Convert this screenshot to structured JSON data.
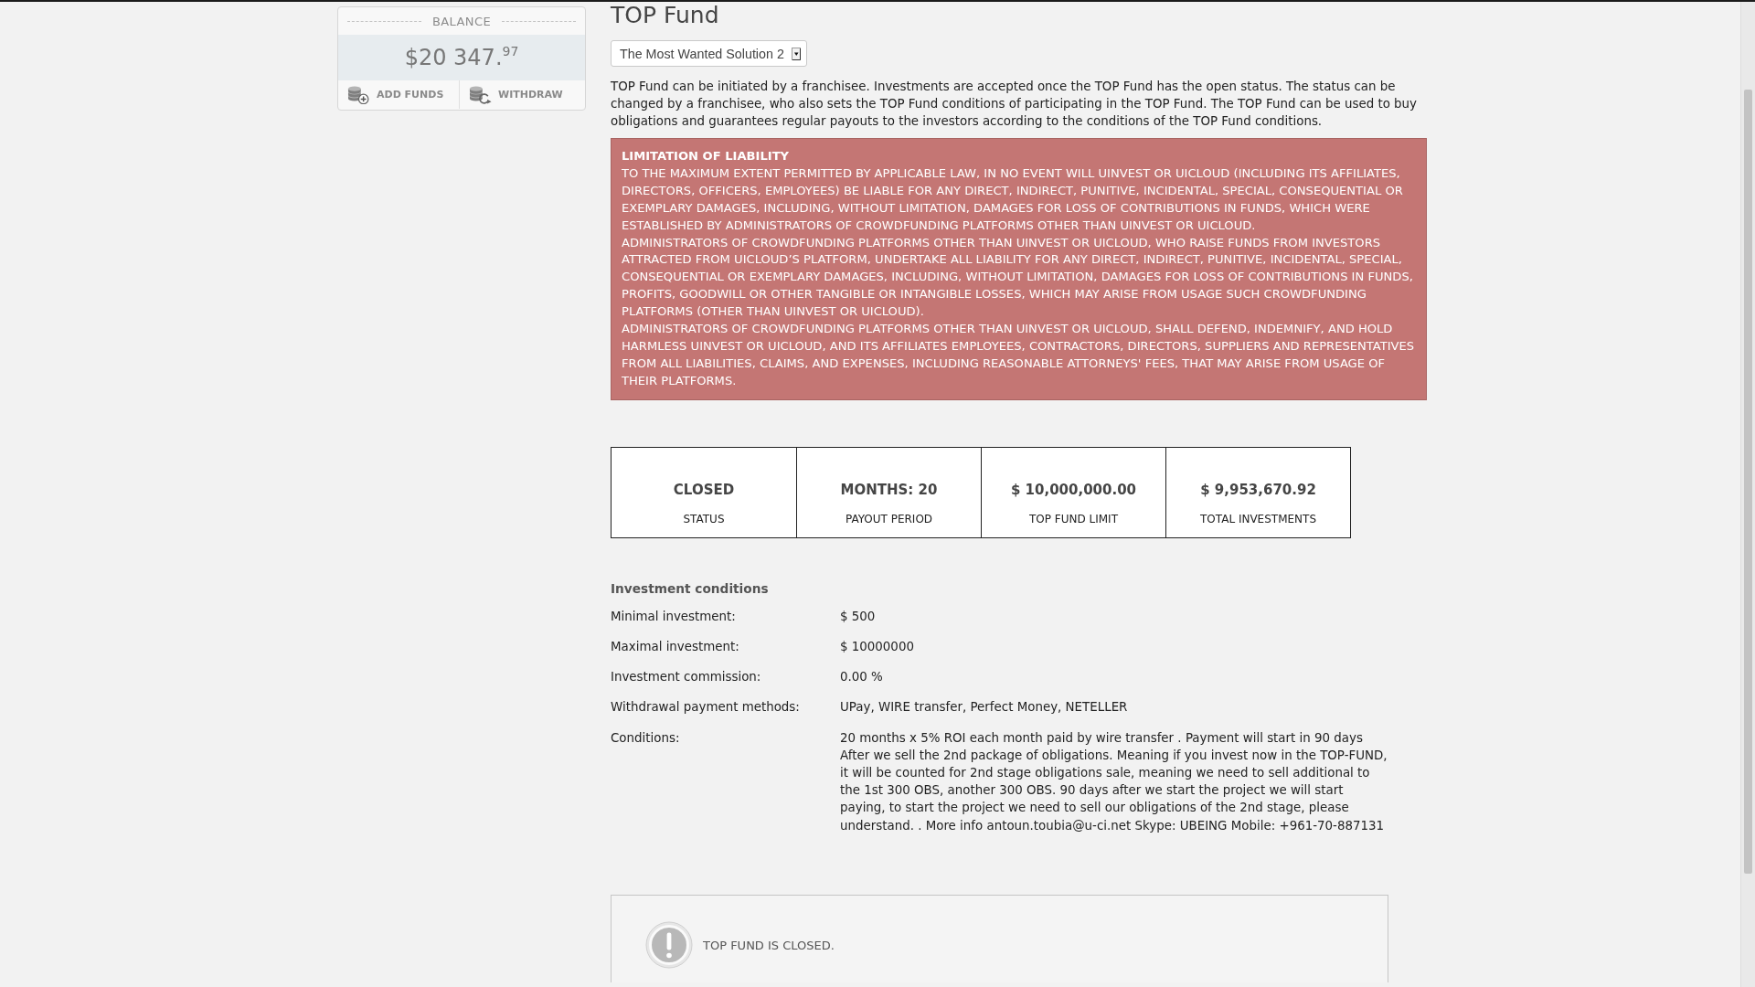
{
  "balance": {
    "heading": "BALANCE",
    "amount": "$20 347.$^{97}$",
    "actions": [
      {
        "label": "ADD FUNDS",
        "kind": "add"
      },
      {
        "label": "WITHDRAW",
        "kind": "withdraw"
      }
    ]
  },
  "title": "TOP Fund",
  "fund_select": {
    "value": "The Most Wanted Solution 2"
  },
  "intro": "TOP Fund can be initiated by a franchisee. Investments are accepted once the TOP Fund has the open status. The status can be changed by a franchisee, who also sets the TOP Fund conditions of participating in the TOP Fund. The TOP Fund can be used to buy obligations and guarantees regular payouts to the investors according to the conditions of the TOP Fund conditions.",
  "liability": {
    "title": "LIMITATION OF LIABILITY",
    "paragraphs": [
      "TO THE MAXIMUM EXTENT PERMITTED BY APPLICABLE LAW, IN NO EVENT WILL UINVEST OR UICLOUD (INCLUDING ITS AFFILIATES, DIRECTORS, OFFICERS, EMPLOYEES) BE LIABLE FOR ANY DIRECT, INDIRECT, PUNITIVE, INCIDENTAL, SPECIAL, CONSEQUENTIAL OR EXEMPLARY DAMAGES, INCLUDING, WITHOUT LIMITATION, DAMAGES FOR LOSS OF CONTRIBUTIONS IN FUNDS, WHICH WERE ESTABLISHED BY ADMINISTRATORS OF CROWDFUNDING PLATFORMS OTHER THAN UINVEST OR UICLOUD.",
      "ADMINISTRATORS OF CROWDFUNDING PLATFORMS OTHER THAN UINVEST OR UICLOUD, WHO RAISE FUNDS FROM INVESTORS ATTRACTED FROM UICLOUD’S PLATFORM, UNDERTAKE ALL LIABILITY FOR ANY DIRECT, INDIRECT, PUNITIVE, INCIDENTAL, SPECIAL, CONSEQUENTIAL OR EXEMPLARY DAMAGES, INCLUDING, WITHOUT LIMITATION, DAMAGES FOR LOSS OF CONTRIBUTIONS IN FUNDS, PROFITS, GOODWILL OR OTHER TANGIBLE OR INTANGIBLE LOSSES, WHICH MAY ARISE FROM USAGE SUCH CROWDFUNDING PLATFORMS (OTHER THAN UINVEST OR UICLOUD).",
      "ADMINISTRATORS OF CROWDFUNDING PLATFORMS OTHER THAN UINVEST OR UICLOUD, SHALL DEFEND, INDEMNIFY, AND HOLD HARMLESS UINVEST OR UICLOUD, AND ITS AFFILIATES EMPLOYEES, CONTRACTORS, DIRECTORS, SUPPLIERS AND REPRESENTATIVES FROM ALL LIABILITIES, CLAIMS, AND EXPENSES, INCLUDING REASONABLE ATTORNEYS' FEES, THAT MAY ARISE FROM USAGE OF THEIR PLATFORMS."
    ]
  },
  "stats": [
    {
      "value": "CLOSED",
      "label": "STATUS"
    },
    {
      "value": "MONTHS: 20",
      "label": "PAYOUT PERIOD"
    },
    {
      "value": "$ 10,000,000.00",
      "label": "TOP FUND LIMIT"
    },
    {
      "value": "$ 9,953,670.92",
      "label": "TOTAL INVESTMENTS"
    }
  ],
  "conditions": {
    "title": "Investment conditions",
    "rows": [
      {
        "label": "Minimal investment:",
        "value": "$ 500"
      },
      {
        "label": "Maximal investment:",
        "value": "$ 10000000"
      },
      {
        "label": "Investment commission:",
        "value": "0.00 %"
      },
      {
        "label": "Withdrawal payment methods:",
        "value": "UPay, WIRE transfer, Perfect Money, NETELLER"
      },
      {
        "label": "Conditions:",
        "value": "20 months x 5% ROI each month paid by wire transfer . Payment will start in 90 days\nAfter we sell the 2nd package of obligations. Meaning if you invest now in the TOP-FUND, it will be counted for 2nd stage obligations sale, meaning we need to sell additional to the 1st 300 OBS, another 300 OBS. 90 days after we start the project we will start paying, to start the project we need to sell our obligations of the 2nd stage, please understand. . More info antoun.toubia@u-ci.net Skype: UBEING Mobile: +961-70-887131"
      }
    ]
  },
  "notice": {
    "text": "TOP FUND IS CLOSED."
  }
}
